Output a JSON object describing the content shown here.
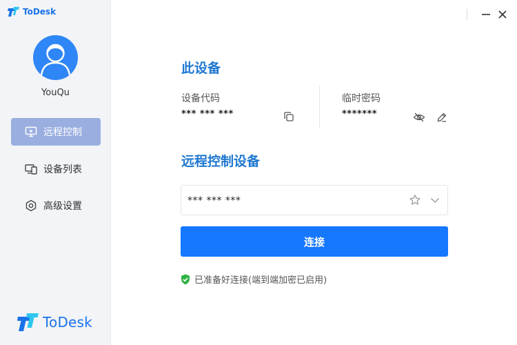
{
  "app": {
    "brand_name": "ToDesk",
    "colors": {
      "brand": "#1a73e8",
      "accent": "#1677ff",
      "active_nav": "#9aaee0",
      "success": "#2fb344"
    }
  },
  "user": {
    "name": "YouQu"
  },
  "sidebar": {
    "items": [
      {
        "label": "远程控制",
        "icon": "monitor-icon",
        "active": true
      },
      {
        "label": "设备列表",
        "icon": "devices-icon",
        "active": false
      },
      {
        "label": "高级设置",
        "icon": "gear-icon",
        "active": false
      }
    ]
  },
  "device": {
    "section_title": "此设备",
    "code_label": "设备代码",
    "code_value": "*** *** ***",
    "password_label": "临时密码",
    "password_value": "*******"
  },
  "remote": {
    "section_title": "远程控制设备",
    "input_value": "*** *** ***",
    "connect_label": "连接",
    "status_text": "已准备好连接(端到端加密已启用)"
  }
}
